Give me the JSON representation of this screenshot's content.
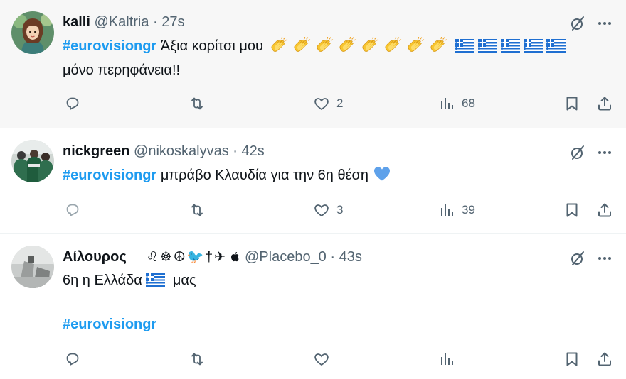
{
  "tweets": [
    {
      "name": "kalli",
      "handle": "@Kaltria",
      "separator": "·",
      "time": "27s",
      "hashtag": "#eurovisiongr",
      "text_after_hashtag": "Άξια κορίτσι μου",
      "line2": "μόνο περηφάνεια!!",
      "emoji_icons": [
        "clapping-hands-icon",
        "greek-flag-icon"
      ],
      "reply_count": "",
      "retweet_count": "",
      "like_count": "2",
      "view_count": "68"
    },
    {
      "name": "nickgreen",
      "handle": "@nikoskalyvas",
      "separator": "·",
      "time": "42s",
      "hashtag": "#eurovisiongr",
      "text_after_hashtag": "μπράβο Κλαυδία για την 6η θέση",
      "emoji_icons": [
        "blue-heart-icon"
      ],
      "reply_count": "",
      "retweet_count": "",
      "like_count": "3",
      "view_count": "39"
    },
    {
      "name": "Αίλουρος",
      "name_symbols": "♌☸☮🐦†✈",
      "handle": "@Placebo_0",
      "separator": "·",
      "time": "43s",
      "line1_before": "6η η Ελλάδα",
      "line1_after": "μας",
      "hashtag": "#eurovisiongr",
      "emoji_icons": [
        "greek-flag-icon",
        "apple-icon"
      ],
      "reply_count": "",
      "retweet_count": "",
      "like_count": "",
      "view_count": ""
    }
  ],
  "icons": {
    "reply": "reply-icon",
    "retweet": "retweet-icon",
    "like": "heart-icon",
    "views": "views-icon",
    "bookmark": "bookmark-icon",
    "share": "share-icon",
    "grok": "grok-icon",
    "more": "more-icon"
  },
  "colors": {
    "hashtag": "#1d9bf0",
    "secondary_text": "#536471",
    "highlight_bg": "#f7f7f7"
  }
}
